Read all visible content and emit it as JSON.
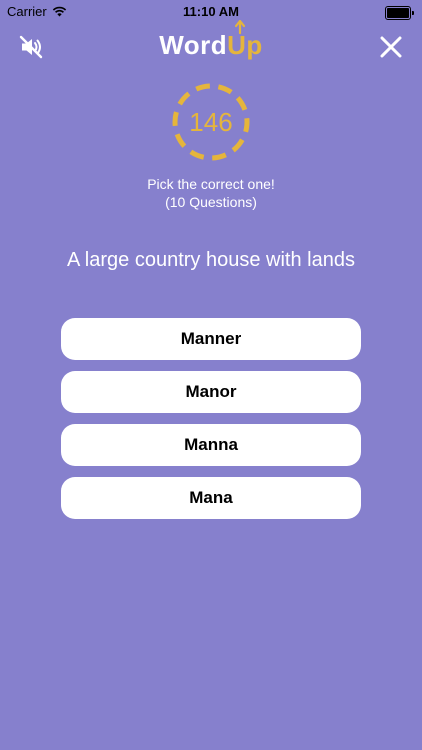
{
  "status_bar": {
    "carrier": "Carrier",
    "time": "11:10 AM"
  },
  "nav": {
    "logo_word": "Word",
    "logo_up": "Up",
    "left_icon": "speaker-muted-icon",
    "right_icon": "close-icon"
  },
  "timer": {
    "value": "146",
    "color": "#e5b53c"
  },
  "instruction": {
    "line1": "Pick the correct one!",
    "line2": "(10 Questions)"
  },
  "question": "A large country house with lands",
  "options": [
    "Manner",
    "Manor",
    "Manna",
    "Mana"
  ],
  "colors": {
    "background": "#8680cd",
    "accent": "#e5b53c",
    "button": "#ffffff"
  }
}
